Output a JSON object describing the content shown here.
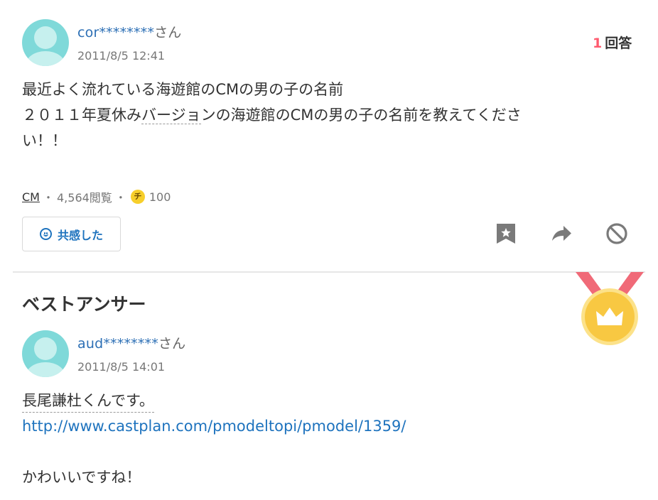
{
  "question": {
    "user": {
      "name_prefix": "cor",
      "name_mask": "********",
      "honorific": "さん"
    },
    "date": "2011/8/5 12:41",
    "answer_count": {
      "number": "1",
      "label": "回答"
    },
    "body": {
      "line1": "最近よく流れている海遊館のCMの男の子の名前",
      "line2a": "２０１１年夏休み",
      "line2b": "バージョ",
      "line2c": "ンの海遊館のCMの男の子の名前を教えてくださ",
      "line3": "い！！"
    },
    "meta": {
      "tag": "CM",
      "sep1": "・",
      "views": "4,564閲覧",
      "sep2": "・",
      "coin_symbol": "チ",
      "coins": "100"
    },
    "empathy_label": "共感した"
  },
  "best_answer": {
    "title": "ベストアンサー",
    "user": {
      "name_prefix": "aud",
      "name_mask": "********",
      "honorific": "さん"
    },
    "date": "2011/8/5 14:01",
    "body": {
      "line1": "長尾謙杜くんです。",
      "link": "http://www.castplan.com/pmodeltopi/pmodel/1359/",
      "line3": "かわいいですね！"
    }
  },
  "colors": {
    "accent_blue": "#1e73be",
    "answer_count_red": "#ff5a6e",
    "avatar_bg": "#7fd9d9",
    "medal_gold": "#f8c842",
    "ribbon_red": "#f06a78"
  }
}
